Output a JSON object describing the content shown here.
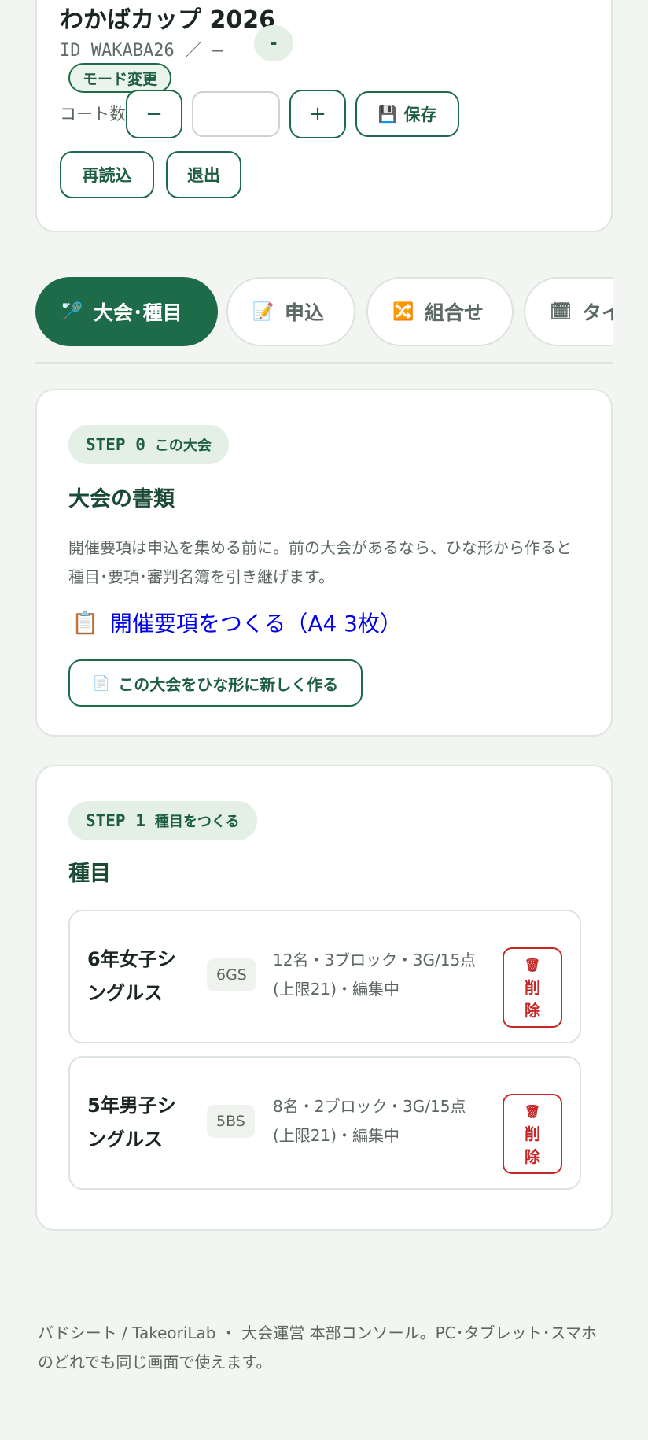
{
  "header": {
    "event_title": "わかばカップ 2026",
    "event_id": "ID WAKABA26 ／ –",
    "status_badge": "-",
    "mode_button": "モード変更",
    "court_label": "コート数",
    "court_value": "",
    "minus_label": "−",
    "plus_label": "+",
    "save_label": "保存",
    "reload_label": "再読込",
    "exit_label": "退出"
  },
  "tabs": [
    {
      "label": "大会･種目",
      "icon": "🏸",
      "active": true
    },
    {
      "label": "申込",
      "icon": "📝",
      "active": false
    },
    {
      "label": "組合せ",
      "icon": "🔀",
      "active": false
    },
    {
      "label": "タイ",
      "icon": "🗓",
      "active": false
    }
  ],
  "step0": {
    "step": "STEP 0",
    "sub": "この大会",
    "title": "大会の書類",
    "description": "開催要項は申込を集める前に。前の大会があるなら、ひな形から作ると種目･要項･審判名簿を引き継げます。",
    "doc_link": "開催要項をつくる（A4 3枚）",
    "template_button": "この大会をひな形に新しく作る"
  },
  "step1": {
    "step": "STEP 1",
    "sub": "種目をつくる",
    "title": "種目",
    "delete_label": "削除",
    "events": [
      {
        "name": "6年女子シングルス",
        "code": "6GS",
        "info": "12名・3ブロック・3G/15点(上限21)・編集中"
      },
      {
        "name": "5年男子シングルス",
        "code": "5BS",
        "info": "8名・2ブロック・3G/15点(上限21)・編集中"
      }
    ]
  },
  "footer": {
    "text": "バドシート / TakeoriLab ・ 大会運営 本部コンソール。PC･タブレット･スマホのどれでも同じ画面で使えます。"
  },
  "colors": {
    "accent": "#1e6b4a",
    "danger": "#c62828",
    "link": "#0000ee",
    "background": "#f3f5f2"
  }
}
